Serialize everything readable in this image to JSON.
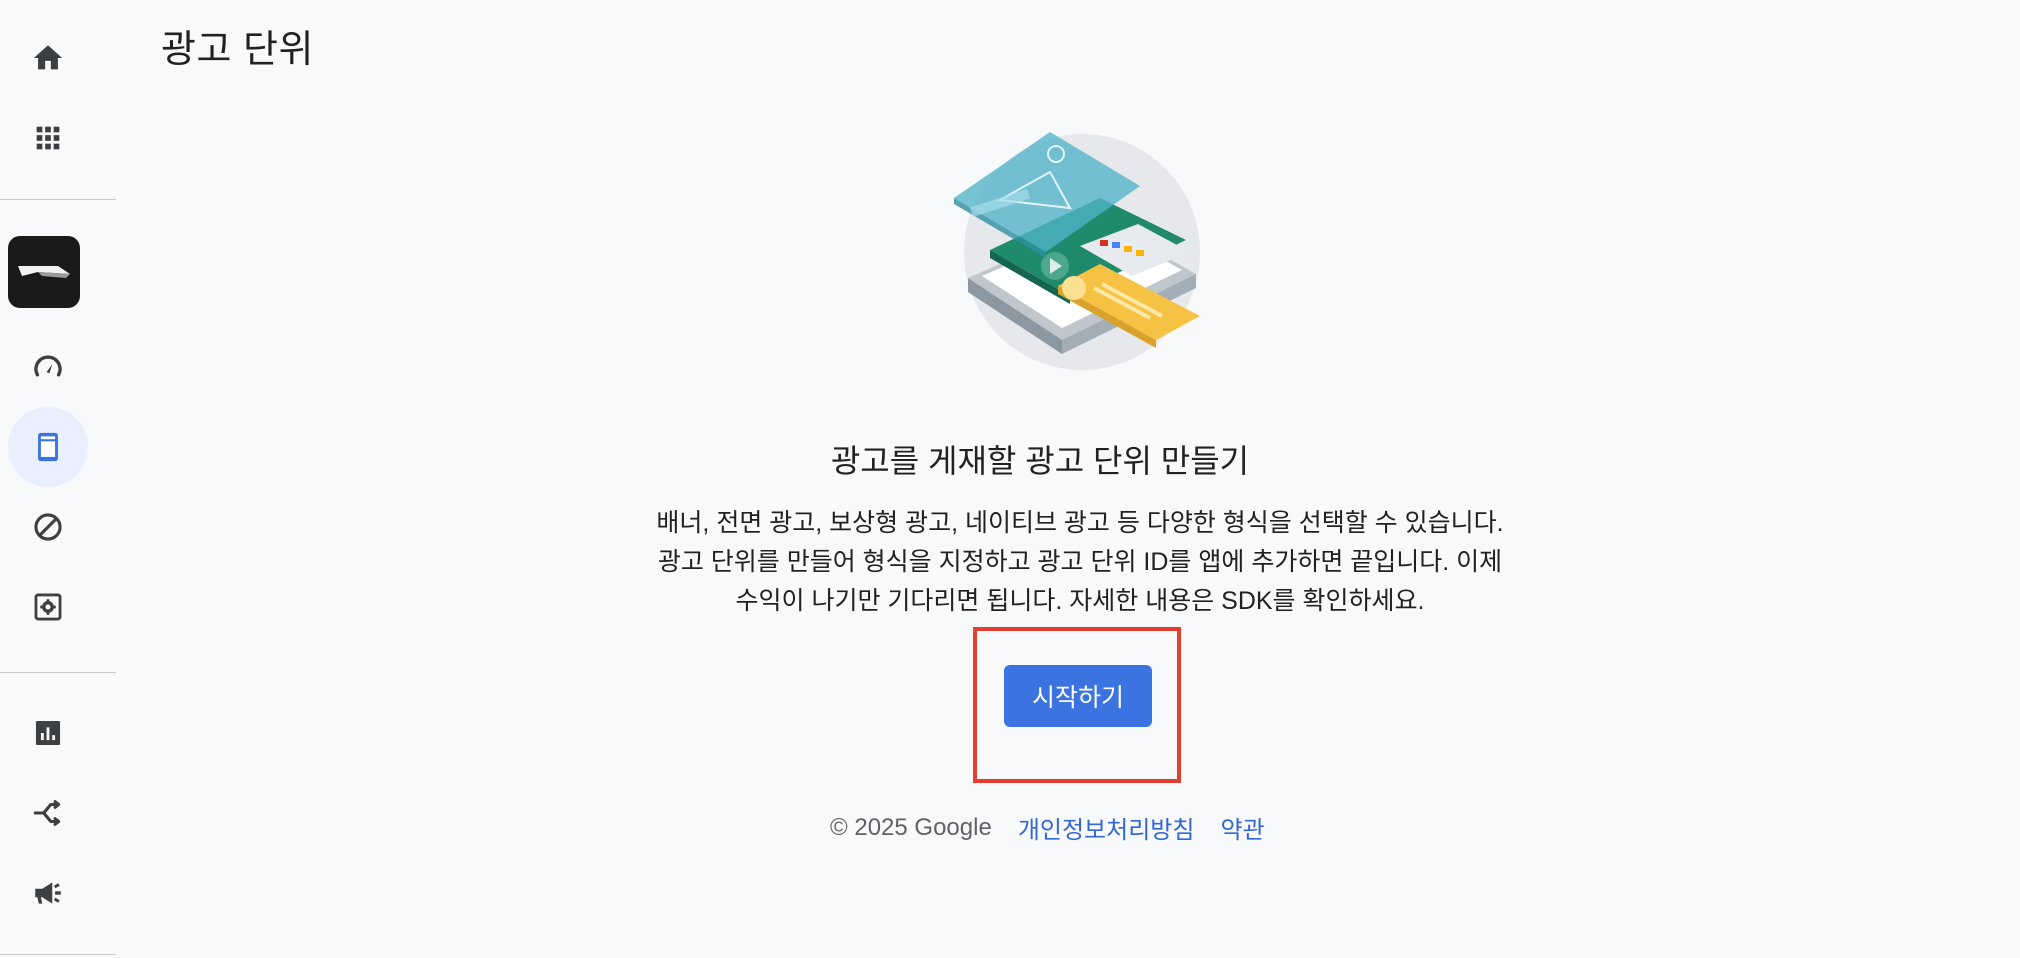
{
  "page": {
    "title": "광고 단위"
  },
  "sidebar": {
    "items": [
      {
        "id": "home",
        "icon": "home-icon"
      },
      {
        "id": "apps",
        "icon": "apps-grid-icon"
      },
      {
        "id": "app",
        "icon": "app-logo"
      },
      {
        "id": "overview",
        "icon": "speedometer-icon"
      },
      {
        "id": "ad-units",
        "icon": "phone-ad-unit-icon",
        "active": true
      },
      {
        "id": "blocking",
        "icon": "block-icon"
      },
      {
        "id": "app-settings",
        "icon": "settings-gear-icon"
      },
      {
        "id": "reports",
        "icon": "bar-chart-icon"
      },
      {
        "id": "mediation",
        "icon": "mediation-merge-icon"
      },
      {
        "id": "campaigns",
        "icon": "megaphone-icon"
      }
    ]
  },
  "empty_state": {
    "heading": "광고를 게재할 광고 단위 만들기",
    "description_lines": [
      "배너, 전면 광고, 보상형 광고, 네이티브 광고 등 다양한 형식을 선택할 수 있습니다.",
      "광고 단위를 만들어 형식을 지정하고 광고 단위 ID를 앱에 추가하면 끝입니다. 이제",
      "수익이 나기만 기다리면 됩니다. 자세한 내용은 SDK를 확인하세요."
    ],
    "cta_label": "시작하기"
  },
  "footer": {
    "copyright": "© 2025 Google",
    "privacy_label": "개인정보처리방침",
    "terms_label": "약관"
  },
  "colors": {
    "accent": "#3b73e0",
    "link": "#3367d6",
    "active_bg": "#e8f0fe",
    "highlight": "#e53e2f",
    "background": "#f8f9fa"
  }
}
